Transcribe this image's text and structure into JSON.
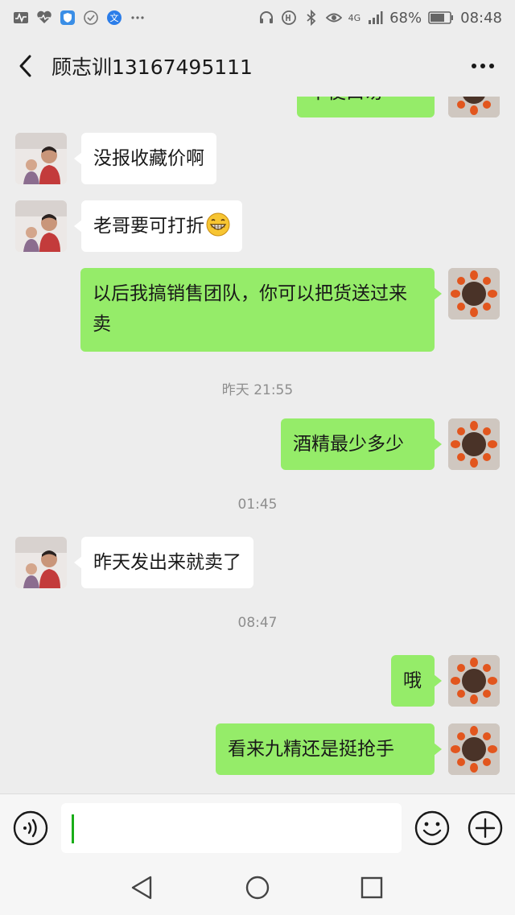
{
  "status": {
    "signal_label": "4G",
    "battery": "68%",
    "time": "08:48"
  },
  "header": {
    "title": "顾志训13167495111"
  },
  "messages": [
    {
      "side": "out",
      "text": "中使口芴",
      "partial": true
    },
    {
      "side": "in",
      "text": "没报收藏价啊"
    },
    {
      "side": "in",
      "text": "老哥要可打折"
    },
    {
      "side": "out",
      "text": "以后我搞销售团队，你可以把货送过来卖"
    },
    {
      "side": "time",
      "text": "昨天 21:55"
    },
    {
      "side": "out",
      "text": "酒精最少多少"
    },
    {
      "side": "time",
      "text": "01:45"
    },
    {
      "side": "in",
      "text": "昨天发出来就卖了"
    },
    {
      "side": "time",
      "text": "08:47"
    },
    {
      "side": "out",
      "text": "哦"
    },
    {
      "side": "out",
      "text": "看来九精还是挺抢手"
    }
  ],
  "input": {
    "value": ""
  },
  "colors": {
    "bg": "#ededed",
    "outgoing": "#95ec69",
    "incoming": "#ffffff",
    "caret": "#1aad19"
  },
  "icons": [
    "back-icon",
    "more-icon",
    "voice-icon",
    "emoji-icon",
    "plus-icon",
    "nav-back-icon",
    "nav-home-icon",
    "nav-recents-icon"
  ]
}
